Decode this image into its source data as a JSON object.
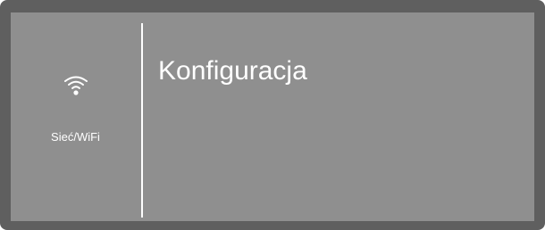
{
  "sidebar": {
    "item": {
      "icon": "wifi-icon",
      "label": "Sieć/WiFi"
    }
  },
  "main": {
    "title": "Konfiguracja"
  },
  "colors": {
    "frame": "#5f5f5f",
    "screen": "#8f8f8f",
    "text": "#ffffff"
  }
}
